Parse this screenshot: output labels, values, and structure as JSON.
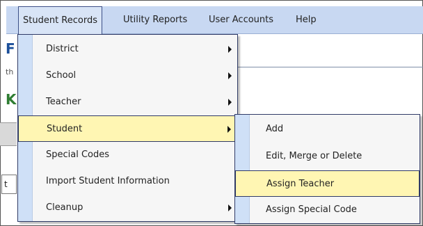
{
  "menubar": {
    "items": [
      {
        "label": "Student Records"
      },
      {
        "label": "Utility Reports"
      },
      {
        "label": "User Accounts"
      },
      {
        "label": "Help"
      }
    ]
  },
  "background": {
    "title_fragment": "F",
    "subtitle_fragment": "th",
    "heading_fragment": "K",
    "input_fragment": "t"
  },
  "student_records_menu": {
    "items": [
      {
        "label": "District",
        "has_submenu": true
      },
      {
        "label": "School",
        "has_submenu": true
      },
      {
        "label": "Teacher",
        "has_submenu": true
      },
      {
        "label": "Student",
        "has_submenu": true,
        "highlighted": true
      },
      {
        "label": "Special Codes",
        "has_submenu": false
      },
      {
        "label": "Import Student Information",
        "has_submenu": false
      },
      {
        "label": "Cleanup",
        "has_submenu": true
      }
    ]
  },
  "student_submenu": {
    "items": [
      {
        "label": "Add"
      },
      {
        "label": "Edit, Merge or Delete"
      },
      {
        "label": "Assign Teacher",
        "highlighted": true
      },
      {
        "label": "Assign Special Code"
      }
    ]
  },
  "colors": {
    "menubar_bg": "#c8d8f2",
    "highlight_bg": "#fff6b3",
    "menu_border": "#2f3a66",
    "title_blue": "#1b4f9a",
    "heading_green": "#2e7d32"
  }
}
